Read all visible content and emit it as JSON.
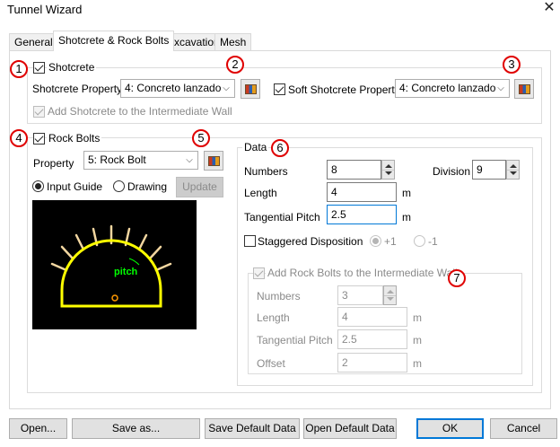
{
  "window": {
    "title": "Tunnel Wizard",
    "close_glyph": "✕"
  },
  "tabs": [
    "General",
    "Shotcrete & Rock Bolts",
    "Excavation",
    "Mesh"
  ],
  "markers": [
    "1",
    "2",
    "3",
    "4",
    "5",
    "6",
    "7"
  ],
  "shotcrete": {
    "label": "Shotcrete",
    "property_label": "Shotcrete Property",
    "property_value": "4: Concreto lanzado",
    "soft_label": "Soft Shotcrete Property",
    "soft_value": "4: Concreto lanzado",
    "intermediate_label": "Add Shotcrete to the Intermediate Wall"
  },
  "rock_bolts": {
    "label": "Rock Bolts",
    "property_label": "Property",
    "property_value": "5: Rock Bolt",
    "input_guide": "Input Guide",
    "drawing": "Drawing",
    "update": "Update",
    "preview_label": "pitch"
  },
  "data": {
    "title": "Data",
    "numbers_label": "Numbers",
    "numbers_value": "8",
    "division_label": "Division",
    "division_value": "9",
    "length_label": "Length",
    "length_value": "4",
    "length_unit": "m",
    "pitch_label": "Tangential Pitch",
    "pitch_value": "2.5",
    "pitch_unit": "m",
    "staggered_label": "Staggered Disposition",
    "plus1": "+1",
    "minus1": "-1"
  },
  "intermediate": {
    "title": "Add Rock Bolts to the Intermediate Wall",
    "numbers_label": "Numbers",
    "numbers_value": "3",
    "length_label": "Length",
    "length_value": "4",
    "length_unit": "m",
    "pitch_label": "Tangential Pitch",
    "pitch_value": "2.5",
    "pitch_unit": "m",
    "offset_label": "Offset",
    "offset_value": "2",
    "offset_unit": "m"
  },
  "footer": {
    "open": "Open...",
    "save_as": "Save as...",
    "save_default": "Save Default Data",
    "open_default": "Open Default Data",
    "ok": "OK",
    "cancel": "Cancel"
  },
  "colors": {
    "accent": "#0078d7",
    "marker": "#e00000",
    "lining": "#ffff00",
    "bolts": "#f2d6a0",
    "pitch": "#00ff00"
  }
}
